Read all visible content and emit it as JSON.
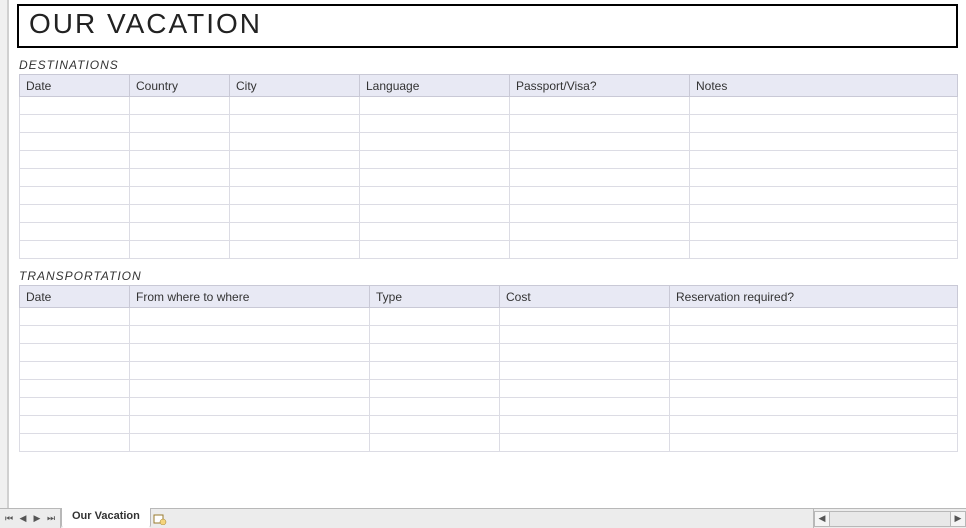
{
  "title": "OUR VACATION",
  "sections": {
    "destinations": {
      "label": "DESTINATIONS",
      "headers": [
        "Date",
        "Country",
        "City",
        "Language",
        "Passport/Visa?",
        "Notes"
      ],
      "row_count": 9
    },
    "transportation": {
      "label": "TRANSPORTATION",
      "headers": [
        "Date",
        "From where to where",
        "Type",
        "Cost",
        "Reservation required?"
      ],
      "row_count": 8
    }
  },
  "tabbar": {
    "active_tab": "Our Vacation"
  }
}
